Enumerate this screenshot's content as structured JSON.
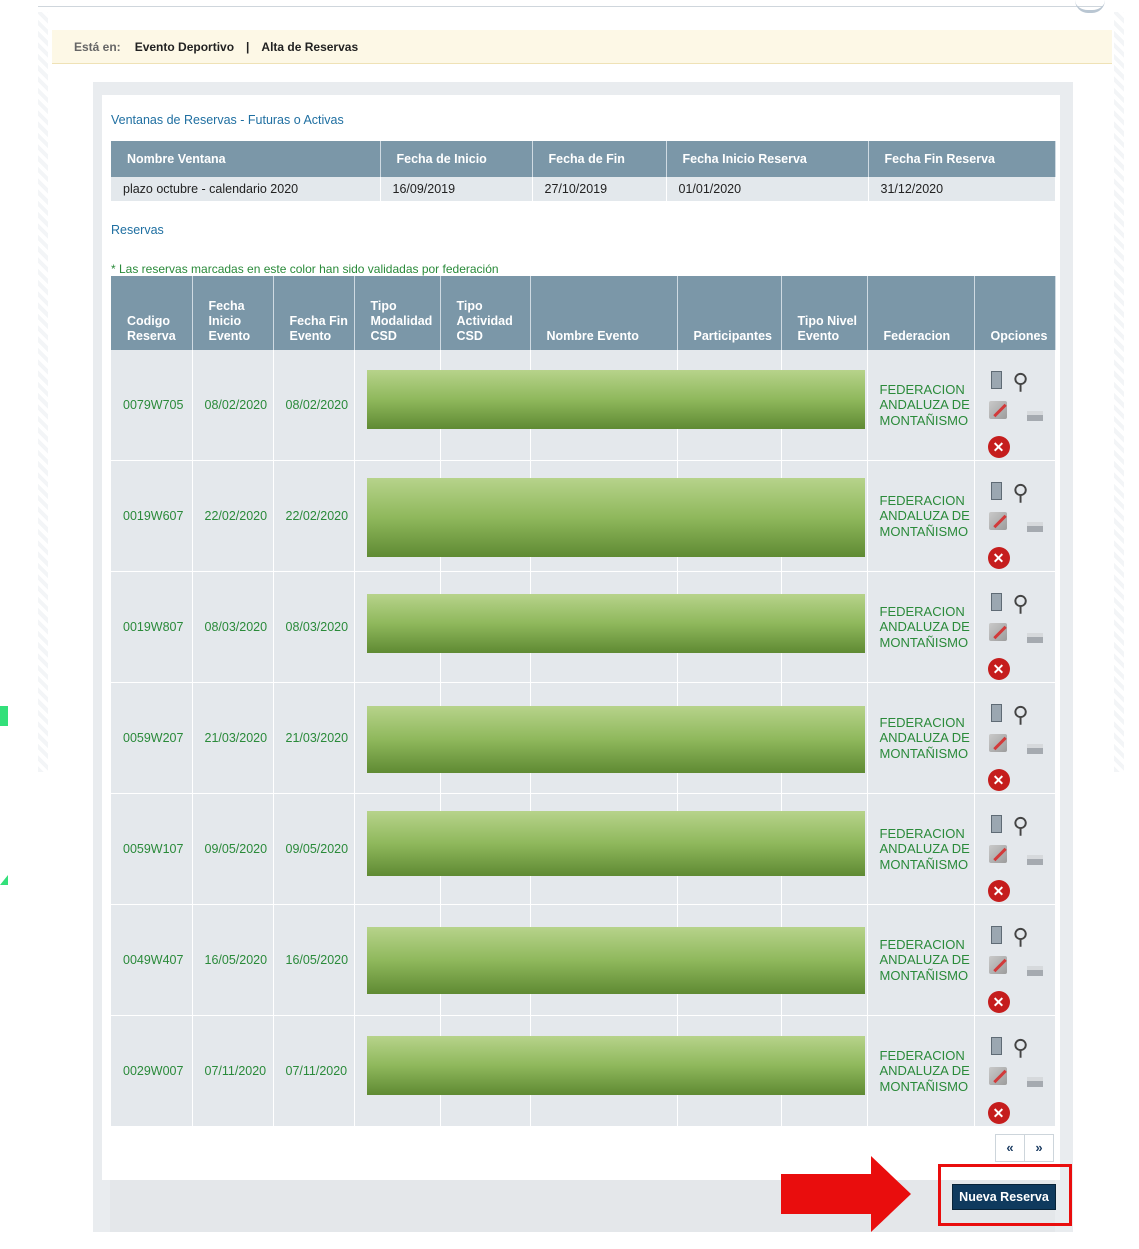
{
  "breadcrumb": {
    "label": "Está en:",
    "items": [
      "Evento Deportivo",
      "Alta de Reservas"
    ]
  },
  "windows": {
    "title": "Ventanas de Reservas - Futuras o Activas",
    "headers": [
      "Nombre Ventana",
      "Fecha de Inicio",
      "Fecha de Fin",
      "Fecha Inicio Reserva",
      "Fecha Fin Reserva"
    ],
    "row": [
      "plazo octubre - calendario 2020",
      "16/09/2019",
      "27/10/2019",
      "01/01/2020",
      "31/12/2020"
    ]
  },
  "reservas": {
    "title": "Reservas",
    "note": "* Las reservas marcadas en este color han sido validadas por federación",
    "headers": {
      "codigo": "Codigo Reserva",
      "fecha_inicio": "Fecha Inicio Evento",
      "fecha_fin": "Fecha Fin Evento",
      "tipo_modalidad": "Tipo Modalidad CSD",
      "tipo_actividad": "Tipo Actividad CSD",
      "nombre_evento": "Nombre Evento",
      "participantes": "Participantes",
      "tipo_nivel": "Tipo Nivel Evento",
      "federacion": "Federacion",
      "opciones": "Opciones"
    },
    "rows": [
      {
        "codigo": "0079W705",
        "inicio": "08/02/2020",
        "fin": "08/02/2020",
        "federacion": "FEDERACION ANDALUZA DE MONTAÑISMO"
      },
      {
        "codigo": "0019W607",
        "inicio": "22/02/2020",
        "fin": "22/02/2020",
        "federacion": "FEDERACION ANDALUZA DE MONTAÑISMO"
      },
      {
        "codigo": "0019W807",
        "inicio": "08/03/2020",
        "fin": "08/03/2020",
        "federacion": "FEDERACION ANDALUZA DE MONTAÑISMO"
      },
      {
        "codigo": "0059W207",
        "inicio": "21/03/2020",
        "fin": "21/03/2020",
        "federacion": "FEDERACION ANDALUZA DE MONTAÑISMO"
      },
      {
        "codigo": "0059W107",
        "inicio": "09/05/2020",
        "fin": "09/05/2020",
        "federacion": "FEDERACION ANDALUZA DE MONTAÑISMO"
      },
      {
        "codigo": "0049W407",
        "inicio": "16/05/2020",
        "fin": "16/05/2020",
        "federacion": "FEDERACION ANDALUZA DE MONTAÑISMO"
      },
      {
        "codigo": "0029W007",
        "inicio": "07/11/2020",
        "fin": "07/11/2020",
        "federacion": "FEDERACION ANDALUZA DE MONTAÑISMO"
      }
    ]
  },
  "pager": {
    "prev": "«",
    "next": "»"
  },
  "icons": {
    "delete": "✕",
    "search": "⚲"
  },
  "actions": {
    "nueva_reserva": "Nueva Reserva"
  },
  "colors": {
    "header": "#7b97a8",
    "validated_text": "#2a8a3a",
    "button": "#0f3a5e",
    "annotation": "#e90d0d"
  }
}
